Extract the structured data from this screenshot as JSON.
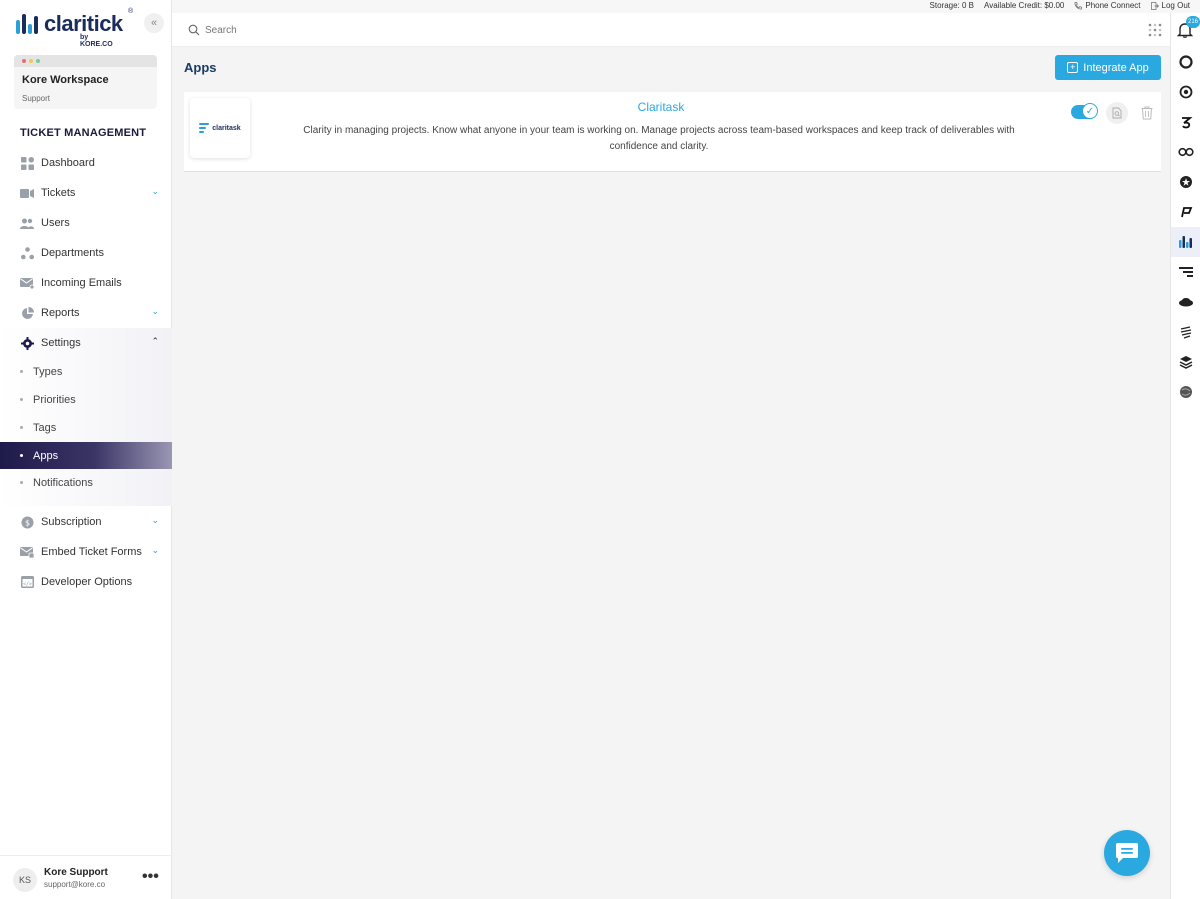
{
  "brand": {
    "name": "claritick",
    "byline": "by KORE.CO",
    "registered": "®"
  },
  "workspace": {
    "name": "Kore Workspace",
    "sub": "Support"
  },
  "sidebar": {
    "section_title": "TICKET MANAGEMENT",
    "items": [
      {
        "label": "Dashboard"
      },
      {
        "label": "Tickets"
      },
      {
        "label": "Users"
      },
      {
        "label": "Departments"
      },
      {
        "label": "Incoming Emails"
      },
      {
        "label": "Reports"
      },
      {
        "label": "Settings"
      },
      {
        "label": "Subscription"
      },
      {
        "label": "Embed Ticket Forms"
      },
      {
        "label": "Developer Options"
      }
    ],
    "settings_sub": [
      {
        "label": "Types"
      },
      {
        "label": "Priorities"
      },
      {
        "label": "Tags"
      },
      {
        "label": "Apps"
      },
      {
        "label": "Notifications"
      }
    ]
  },
  "user": {
    "initials": "KS",
    "name": "Kore Support",
    "email": "support@kore.co"
  },
  "status": {
    "storage": "Storage: 0 B",
    "credit": "Available Credit: $0.00",
    "phone": "Phone Connect",
    "logout": "Log Out"
  },
  "search": {
    "placeholder": "Search",
    "value": ""
  },
  "notifications": {
    "count": "216"
  },
  "main": {
    "title": "Apps",
    "integrate_label": "Integrate App",
    "apps": [
      {
        "name": "Claritask",
        "logo_text": "claritask",
        "description": "Clarity in managing projects. Know what anyone in your team is working on. Manage projects across team-based workspaces and keep track of deliverables with confidence and clarity."
      }
    ]
  },
  "colors": {
    "accent": "#2aa8e0",
    "brand_dark": "#1a2b5e",
    "active_nav": "#1e1a4a"
  }
}
